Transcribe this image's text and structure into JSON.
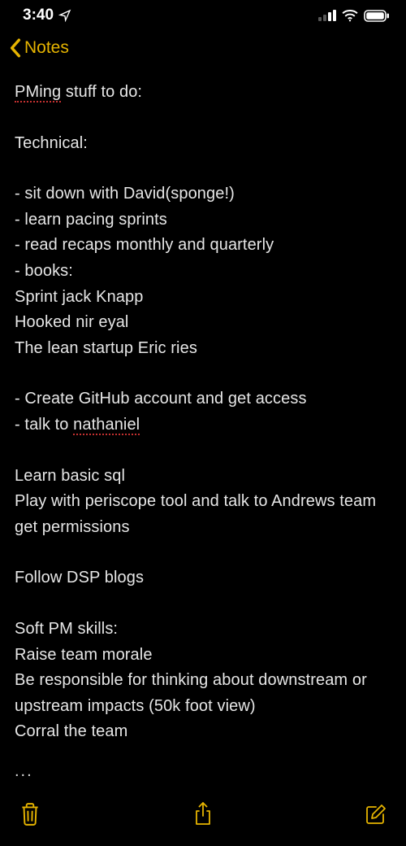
{
  "status": {
    "time": "3:40"
  },
  "nav": {
    "back_label": "Notes"
  },
  "note": {
    "title_pre": "PMing",
    "title_post": " stuff to do:",
    "section_technical": "Technical:",
    "l1": "- sit down with David(sponge!)",
    "l2": "- learn pacing sprints",
    "l3": "- read recaps monthly and quarterly",
    "l4": "- books:",
    "l5": "Sprint jack Knapp",
    "l6": "Hooked  nir eyal",
    "l7": "The lean startup Eric ries",
    "l8": "- Create GitHub account and get access",
    "l9_pre": "- talk to ",
    "l9_spell": "nathaniel",
    "l10": "Learn basic sql",
    "l11": "Play with periscope tool and talk to Andrews team get permissions",
    "l12": "Follow DSP blogs",
    "section_soft": "Soft PM skills:",
    "s1": "Raise team morale",
    "s2": "Be responsible for thinking about downstream or upstream impacts (50k foot view)",
    "s3": "Corral the team"
  },
  "colors": {
    "accent": "#e6b400",
    "bg": "#000000",
    "text": "#e6e6e6",
    "spell": "#c43030"
  }
}
